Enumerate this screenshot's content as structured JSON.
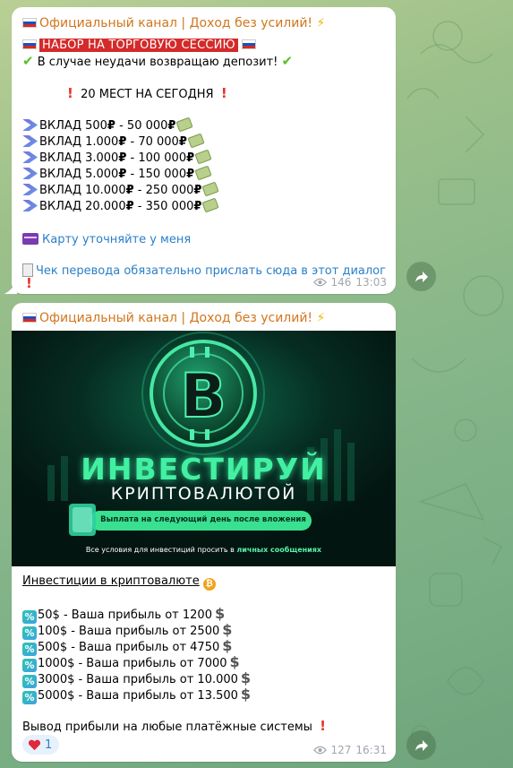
{
  "colors": {
    "accent_link": "#2a7fc8",
    "sender": "#d1761c",
    "highlight_red": "#d42a2a",
    "banner_green": "#3ae89a"
  },
  "messages": [
    {
      "sender": "Официальный канал | Доход без усилий!",
      "headline": "НАБОР НА ТОРГОВУЮ СЕССИЮ",
      "refund_line": "В случае неудачи возвращаю депозит!",
      "slots_line": "20 МЕСТ НА СЕГОДНЯ",
      "deposits": [
        {
          "from": "ВКЛАД 500",
          "to": " - 50 000"
        },
        {
          "from": "ВКЛАД 1.000",
          "to": " - 70 000"
        },
        {
          "from": "ВКЛАД 3.000",
          "to": " - 100 000"
        },
        {
          "from": "ВКЛАД 5.000",
          "to": " - 150 000"
        },
        {
          "from": "ВКЛАД 10.000",
          "to": " - 250 000"
        },
        {
          "from": "ВКЛАД 20.000",
          "to": " - 350 000"
        }
      ],
      "currency": "₽",
      "card_line": "Карту уточняйте у меня",
      "receipt_line": "Чек перевода обязательно прислать сюда в этот диалог",
      "views": "146",
      "time": "13:03"
    },
    {
      "sender": "Официальный канал | Доход без усилий!",
      "banner": {
        "title": "ИНВЕСТИРУЙ",
        "subtitle": "КРИПТОВАЛЮТОЙ",
        "pill": "Выплата на следующий день после вложения",
        "footer_prefix": "Все условия для инвестиций просить в ",
        "footer_bold": "личных сообщениях"
      },
      "heading": "Инвестиции в криптовалюте",
      "offers": [
        "50$ - Ваша прибыль от 1200",
        "100$ - Ваша прибыль от 2500",
        "500$ - Ваша прибыль от 4750",
        "1000$ - Ваша прибыль от 7000",
        "3000$ - Ваша прибыль от 10.000",
        "5000$ - Ваша прибыль от 13.500"
      ],
      "withdraw_line": "Вывод прибыли на любые платёжные системы",
      "reaction_count": "1",
      "views": "127",
      "time": "16:31"
    }
  ]
}
